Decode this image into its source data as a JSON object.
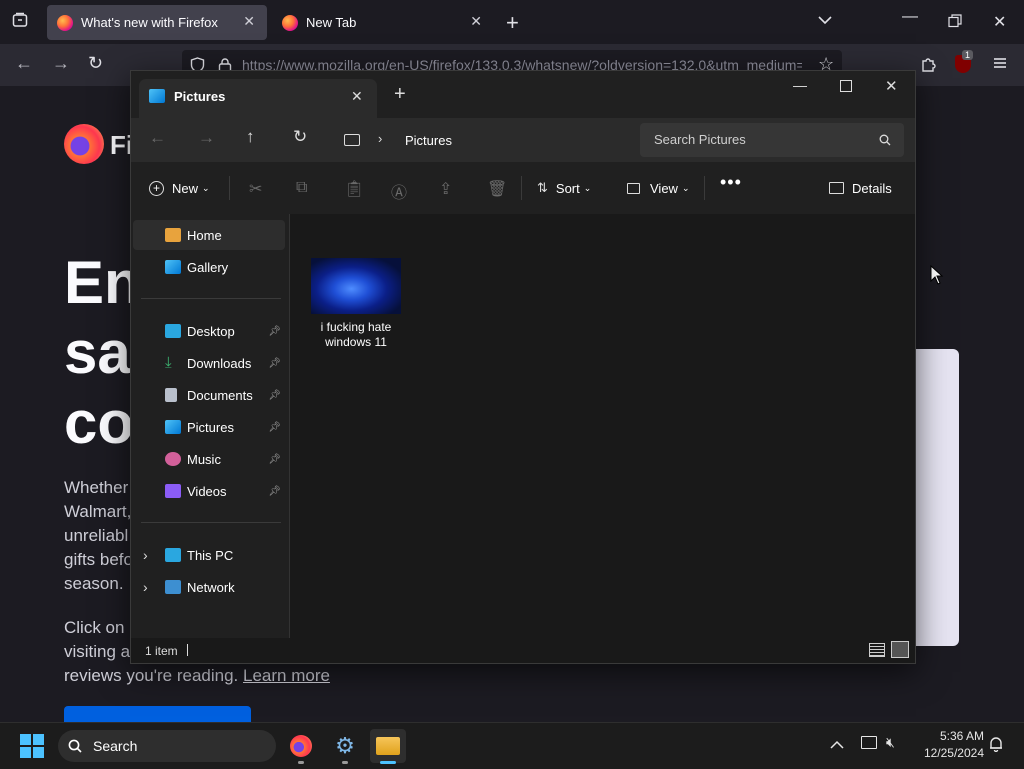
{
  "firefox": {
    "tabs": [
      {
        "title": "What's new with Firefox",
        "active": true
      },
      {
        "title": "New Tab",
        "active": false
      }
    ],
    "url": "https://www.mozilla.org/en-US/firefox/133.0.3/whatsnew/?oldversion=132.0&utm_medium=",
    "ublock_badge": "1"
  },
  "webpage": {
    "logo_text": "Fi",
    "hero_lines": [
      "En",
      "sa",
      "co"
    ],
    "para1": [
      "Whether",
      "Walmart,",
      "unreliabl",
      "gifts befo",
      "season."
    ],
    "para2_lines": [
      "Click on",
      "visiting a"
    ],
    "para2_last": "reviews you're reading.",
    "learn_more": "Learn more"
  },
  "explorer": {
    "tab_title": "Pictures",
    "breadcrumb": "Pictures",
    "search_placeholder": "Search Pictures",
    "toolbar": {
      "new": "New",
      "sort": "Sort",
      "view": "View",
      "details": "Details"
    },
    "sidebar": {
      "home": "Home",
      "gallery": "Gallery",
      "desktop": "Desktop",
      "downloads": "Downloads",
      "documents": "Documents",
      "pictures": "Pictures",
      "music": "Music",
      "videos": "Videos",
      "this_pc": "This PC",
      "network": "Network"
    },
    "file": {
      "name_line1": "i fucking hate",
      "name_line2": "windows 11"
    },
    "status": "1 item"
  },
  "taskbar": {
    "search": "Search",
    "time": "5:36 AM",
    "date": "12/25/2024"
  }
}
